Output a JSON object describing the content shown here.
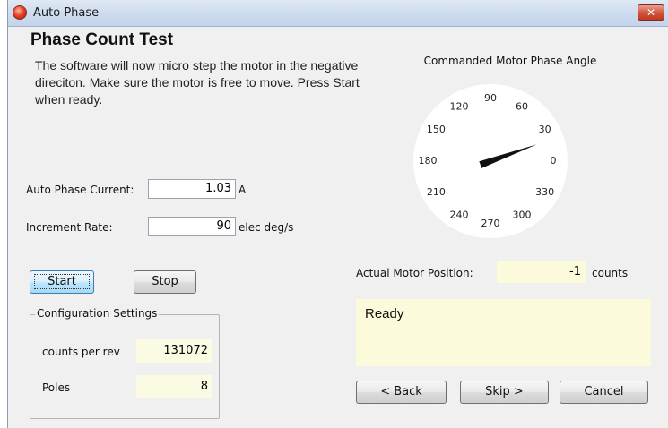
{
  "window": {
    "title": "Auto Phase",
    "close_glyph": "✕"
  },
  "page": {
    "heading": "Phase Count Test",
    "instructions": "The software will now micro step the motor in the negative direciton.  Make sure the motor is free to move. Press Start when ready."
  },
  "inputs": {
    "current_label": "Auto Phase Current:",
    "current_value": "1.03",
    "current_unit": "A",
    "rate_label": "Increment Rate:",
    "rate_value": "90",
    "rate_unit": "elec deg/s"
  },
  "buttons": {
    "start": "Start",
    "stop": "Stop",
    "back": "< Back",
    "skip": "Skip >",
    "cancel": "Cancel"
  },
  "config": {
    "title": "Configuration Settings",
    "counts_label": "counts per rev",
    "counts_value": "131072",
    "poles_label": "Poles",
    "poles_value": "8"
  },
  "gauge": {
    "title": "Commanded Motor Phase Angle",
    "angle_deg": 20,
    "tick_labels": [
      "0",
      "30",
      "60",
      "90",
      "120",
      "150",
      "180",
      "210",
      "240",
      "270",
      "300",
      "330"
    ]
  },
  "position": {
    "label": "Actual Motor Position:",
    "value": "-1",
    "unit": "counts"
  },
  "status": {
    "text": "Ready"
  },
  "colors": {
    "readout_bg": "#fbfbdc",
    "window_bg": "#f0f0f0",
    "close_red": "#c0381f"
  }
}
